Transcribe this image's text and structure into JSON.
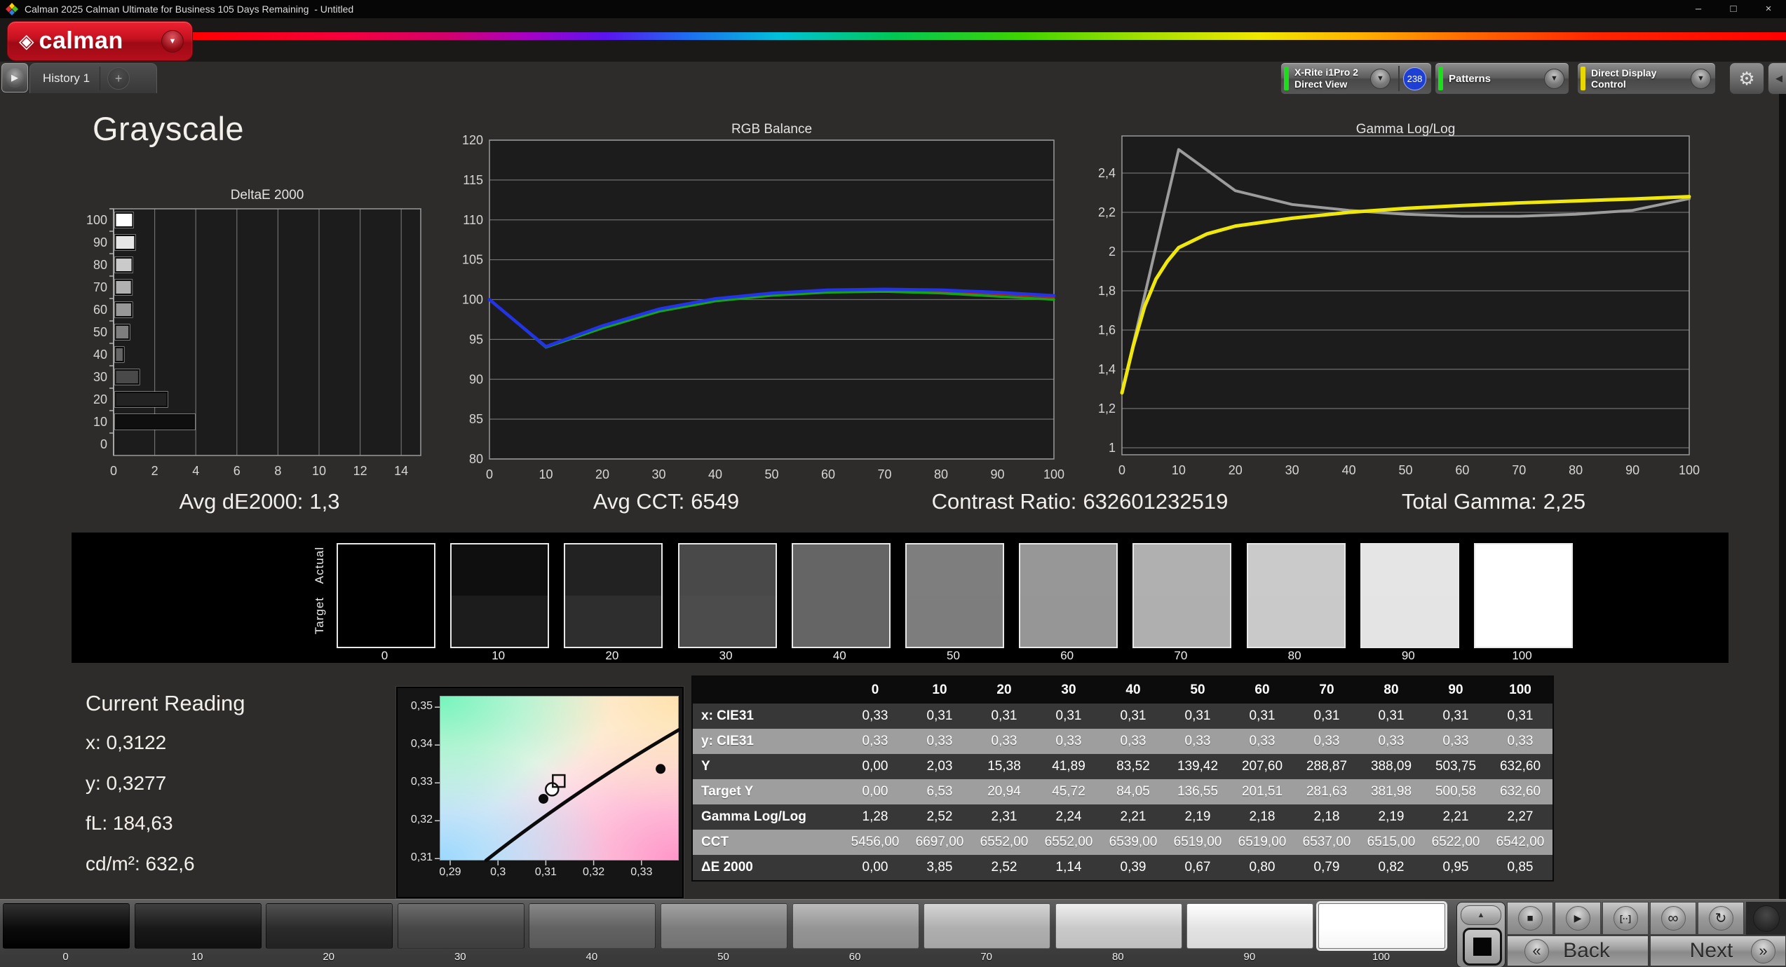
{
  "window": {
    "title": "Calman 2025 Calman Ultimate for Business 105 Days Remaining  - Untitled"
  },
  "icons": {
    "window_min": "–",
    "window_max": "□",
    "window_close": "×",
    "brand_diamond": "◈",
    "dropdown_arrow": "▼",
    "play_tab": "▶",
    "gear": "⚙",
    "collapse_left": "◀",
    "panel_up": "▲",
    "stop": "■",
    "play": "▶",
    "frame": "[··]",
    "loop": "∞",
    "refresh": "↻",
    "back_chevron": "«",
    "next_chevron": "»"
  },
  "brand": {
    "name": "calman"
  },
  "tab_bar": {
    "history_tab": "History 1",
    "add_tab": "+"
  },
  "toolbar": {
    "meter": {
      "line1": "X-Rite i1Pro 2",
      "line2": "Direct View",
      "badge": "238",
      "status_color": "#1ddd1d"
    },
    "patterns": {
      "label": "Patterns",
      "status_color": "#1ddd1d"
    },
    "ddc": {
      "label": "Direct Display Control",
      "status_color": "#e8d800"
    }
  },
  "page": {
    "heading": "Grayscale"
  },
  "stats": [
    {
      "label": "Avg dE2000:",
      "value": "1,3"
    },
    {
      "label": "Avg CCT:",
      "value": "6549"
    },
    {
      "label": "Contrast Ratio:",
      "value": "632601232519"
    },
    {
      "label": "Total Gamma:",
      "value": "2,25"
    }
  ],
  "chart_data": [
    {
      "type": "bar",
      "orientation": "horizontal",
      "title": "DeltaE 2000",
      "categories": [
        100,
        90,
        80,
        70,
        60,
        50,
        40,
        30,
        20,
        10,
        0
      ],
      "values": [
        0.85,
        0.95,
        0.82,
        0.79,
        0.8,
        0.67,
        0.39,
        1.14,
        2.52,
        3.85,
        0.0
      ],
      "xlim": [
        0,
        14
      ],
      "xticks": [
        0,
        2,
        4,
        6,
        8,
        10,
        12,
        14
      ],
      "grid": true
    },
    {
      "type": "line",
      "title": "RGB Balance",
      "xticks": [
        0,
        10,
        20,
        30,
        40,
        50,
        60,
        70,
        80,
        90,
        100
      ],
      "ylim": [
        80,
        120
      ],
      "yticks": [
        {
          "v": 120,
          "label": "120"
        },
        {
          "v": 115,
          "label": "115"
        },
        {
          "v": 110,
          "label": "110"
        },
        {
          "v": 105,
          "label": "105"
        },
        {
          "v": 100,
          "label": "100"
        },
        {
          "v": 95,
          "label": "95"
        },
        {
          "v": 90,
          "label": "90"
        },
        {
          "v": 85,
          "label": "85"
        },
        {
          "v": 80,
          "label": "80"
        }
      ],
      "series": [
        {
          "name": "Red Balance",
          "color": "#bb2020",
          "x": [
            0,
            10,
            20,
            30,
            40,
            50,
            60,
            70,
            80,
            90,
            100
          ],
          "values": [
            100,
            94.1,
            96.5,
            98.6,
            99.9,
            100.6,
            101.0,
            101.1,
            101.0,
            100.7,
            100.3
          ]
        },
        {
          "name": "Green Balance",
          "color": "#17a317",
          "x": [
            0,
            10,
            20,
            30,
            40,
            50,
            60,
            70,
            80,
            90,
            100
          ],
          "values": [
            100,
            94.0,
            96.4,
            98.5,
            99.8,
            100.5,
            100.9,
            101.0,
            100.8,
            100.4,
            100.0
          ]
        },
        {
          "name": "Blue Balance",
          "color": "#2334e8",
          "x": [
            0,
            10,
            20,
            30,
            40,
            50,
            60,
            70,
            80,
            90,
            100
          ],
          "values": [
            100,
            94.1,
            96.7,
            98.8,
            100.1,
            100.8,
            101.2,
            101.3,
            101.2,
            100.9,
            100.5
          ]
        }
      ]
    },
    {
      "type": "line",
      "title": "Gamma Log/Log",
      "xticks": [
        0,
        10,
        20,
        30,
        40,
        50,
        60,
        70,
        80,
        90,
        100
      ],
      "ylim": [
        0.9643,
        2.5893
      ],
      "yticks": [
        {
          "v": 2.4,
          "label": "2,4"
        },
        {
          "v": 2.2,
          "label": "2,2"
        },
        {
          "v": 2.0,
          "label": "2"
        },
        {
          "v": 1.8,
          "label": "1,8"
        },
        {
          "v": 1.6,
          "label": "1,6"
        },
        {
          "v": 1.4,
          "label": "1,4"
        },
        {
          "v": 1.2,
          "label": "1,2"
        },
        {
          "v": 1.0,
          "label": "1"
        }
      ],
      "series": [
        {
          "name": "Measured Gamma",
          "color": "#9c9c9c",
          "x": [
            0,
            10,
            20,
            30,
            40,
            50,
            60,
            70,
            80,
            90,
            100
          ],
          "values": [
            1.28,
            2.52,
            2.31,
            2.24,
            2.21,
            2.19,
            2.18,
            2.18,
            2.19,
            2.21,
            2.27
          ]
        },
        {
          "name": "Target Gamma",
          "color": "#f0e80c",
          "x": [
            0,
            2,
            4,
            6,
            8,
            10,
            15,
            20,
            25,
            30,
            40,
            50,
            60,
            70,
            80,
            90,
            100
          ],
          "values": [
            1.28,
            1.52,
            1.72,
            1.86,
            1.95,
            2.02,
            2.09,
            2.13,
            2.15,
            2.17,
            2.2,
            2.22,
            2.235,
            2.248,
            2.258,
            2.268,
            2.28
          ]
        }
      ]
    },
    {
      "type": "scatter",
      "title": "CIE 1931 chromaticity (zoom)",
      "xlim": [
        0.2878,
        0.3378
      ],
      "ylim": [
        0.3095,
        0.353
      ],
      "xticks": [
        {
          "v": 0.29,
          "label": "0,29"
        },
        {
          "v": 0.3,
          "label": "0,3"
        },
        {
          "v": 0.31,
          "label": "0,31"
        },
        {
          "v": 0.32,
          "label": "0,32"
        },
        {
          "v": 0.33,
          "label": "0,33"
        }
      ],
      "yticks": [
        {
          "v": 0.35,
          "label": "0,35"
        },
        {
          "v": 0.34,
          "label": "0,34"
        },
        {
          "v": 0.33,
          "label": "0,33"
        },
        {
          "v": 0.32,
          "label": "0,32"
        },
        {
          "v": 0.31,
          "label": "0,31"
        }
      ],
      "locus": [
        [
          0.2975,
          0.3095
        ],
        [
          0.305,
          0.317
        ],
        [
          0.312,
          0.3238
        ],
        [
          0.32,
          0.331
        ],
        [
          0.328,
          0.3372
        ],
        [
          0.3378,
          0.344
        ]
      ],
      "points": [
        {
          "x": 0.3095,
          "y": 0.3258,
          "marker": "dot"
        },
        {
          "x": 0.334,
          "y": 0.3337,
          "marker": "dot"
        },
        {
          "x": 0.3113,
          "y": 0.3283,
          "marker": "open-circle"
        },
        {
          "x": 0.3127,
          "y": 0.3305,
          "marker": "open-square"
        }
      ]
    }
  ],
  "swatch_strip": {
    "row_labels": [
      "Actual",
      "Target"
    ],
    "levels": [
      "0",
      "10",
      "20",
      "30",
      "40",
      "50",
      "60",
      "70",
      "80",
      "90",
      "100"
    ],
    "actual_colors": [
      "#000000",
      "#0f0f0f",
      "#222222",
      "#494949",
      "#656565",
      "#7e7e7e",
      "#979797",
      "#b0b0b0",
      "#cacaca",
      "#e5e5e5",
      "#ffffff"
    ],
    "target_colors": [
      "#000000",
      "#1c1c1c",
      "#2e2e2e",
      "#4c4c4c",
      "#656565",
      "#7d7d7d",
      "#969696",
      "#afafaf",
      "#c9c9c9",
      "#e4e4e4",
      "#ffffff"
    ]
  },
  "current_reading": {
    "heading": "Current Reading",
    "items": [
      {
        "label": "x",
        "value": "0,3122"
      },
      {
        "label": "y",
        "value": "0,3277"
      },
      {
        "label": "fL",
        "value": "184,63"
      },
      {
        "label": "cd/m²",
        "value": "632,6"
      }
    ]
  },
  "table": {
    "columns": [
      "0",
      "10",
      "20",
      "30",
      "40",
      "50",
      "60",
      "70",
      "80",
      "90",
      "100"
    ],
    "rows": [
      {
        "label": "x: CIE31",
        "values": [
          "0,33",
          "0,31",
          "0,31",
          "0,31",
          "0,31",
          "0,31",
          "0,31",
          "0,31",
          "0,31",
          "0,31",
          "0,31"
        ]
      },
      {
        "label": "y: CIE31",
        "values": [
          "0,33",
          "0,33",
          "0,33",
          "0,33",
          "0,33",
          "0,33",
          "0,33",
          "0,33",
          "0,33",
          "0,33",
          "0,33"
        ]
      },
      {
        "label": "Y",
        "values": [
          "0,00",
          "2,03",
          "15,38",
          "41,89",
          "83,52",
          "139,42",
          "207,60",
          "288,87",
          "388,09",
          "503,75",
          "632,60"
        ]
      },
      {
        "label": "Target Y",
        "values": [
          "0,00",
          "6,53",
          "20,94",
          "45,72",
          "84,05",
          "136,55",
          "201,51",
          "281,63",
          "381,98",
          "500,58",
          "632,60"
        ]
      },
      {
        "label": "Gamma Log/Log",
        "values": [
          "1,28",
          "2,52",
          "2,31",
          "2,24",
          "2,21",
          "2,19",
          "2,18",
          "2,18",
          "2,19",
          "2,21",
          "2,27"
        ]
      },
      {
        "label": "CCT",
        "values": [
          "5456,00",
          "6697,00",
          "6552,00",
          "6552,00",
          "6539,00",
          "6519,00",
          "6519,00",
          "6537,00",
          "6515,00",
          "6522,00",
          "6542,00"
        ]
      },
      {
        "label": "ΔE 2000",
        "values": [
          "0,00",
          "3,85",
          "2,52",
          "1,14",
          "0,39",
          "0,67",
          "0,80",
          "0,79",
          "0,82",
          "0,95",
          "0,85"
        ]
      }
    ]
  },
  "bottom_bar": {
    "levels": [
      "0",
      "10",
      "20",
      "30",
      "40",
      "50",
      "60",
      "70",
      "80",
      "90",
      "100"
    ],
    "colors": [
      "#0b0b0b",
      "#191919",
      "#2b2b2b",
      "#474747",
      "#626262",
      "#7c7c7c",
      "#959595",
      "#afafaf",
      "#c9c9c9",
      "#e3e3e3",
      "#ffffff"
    ],
    "selected_index": 10,
    "back_label": "Back",
    "next_label": "Next"
  }
}
